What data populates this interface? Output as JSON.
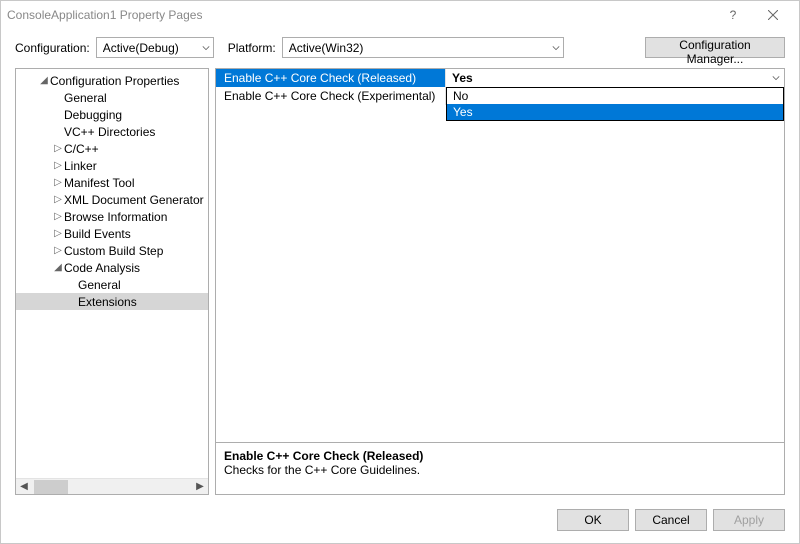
{
  "window": {
    "title": "ConsoleApplication1 Property Pages"
  },
  "toolbar": {
    "config_label": "Configuration:",
    "config_value": "Active(Debug)",
    "platform_label": "Platform:",
    "platform_value": "Active(Win32)",
    "config_mgr": "Configuration Manager..."
  },
  "tree": {
    "root": "Configuration Properties",
    "items": [
      {
        "label": "General",
        "indent": 2,
        "arrow": ""
      },
      {
        "label": "Debugging",
        "indent": 2,
        "arrow": ""
      },
      {
        "label": "VC++ Directories",
        "indent": 2,
        "arrow": ""
      },
      {
        "label": "C/C++",
        "indent": 2,
        "arrow": "▷"
      },
      {
        "label": "Linker",
        "indent": 2,
        "arrow": "▷"
      },
      {
        "label": "Manifest Tool",
        "indent": 2,
        "arrow": "▷"
      },
      {
        "label": "XML Document Generator",
        "indent": 2,
        "arrow": "▷"
      },
      {
        "label": "Browse Information",
        "indent": 2,
        "arrow": "▷"
      },
      {
        "label": "Build Events",
        "indent": 2,
        "arrow": "▷"
      },
      {
        "label": "Custom Build Step",
        "indent": 2,
        "arrow": "▷"
      },
      {
        "label": "Code Analysis",
        "indent": 2,
        "arrow": "◢"
      },
      {
        "label": "General",
        "indent": 3,
        "arrow": ""
      },
      {
        "label": "Extensions",
        "indent": 3,
        "arrow": "",
        "selected": true
      }
    ]
  },
  "grid": {
    "rows": [
      {
        "name": "Enable C++ Core Check (Released)",
        "value": "Yes",
        "selected": true,
        "dropdown": true
      },
      {
        "name": "Enable C++ Core Check (Experimental)",
        "value": "No"
      }
    ],
    "options": [
      {
        "label": "No"
      },
      {
        "label": "Yes",
        "highlight": true
      }
    ]
  },
  "desc": {
    "title": "Enable C++ Core Check (Released)",
    "body": "Checks for the C++ Core Guidelines."
  },
  "footer": {
    "ok": "OK",
    "cancel": "Cancel",
    "apply": "Apply"
  }
}
